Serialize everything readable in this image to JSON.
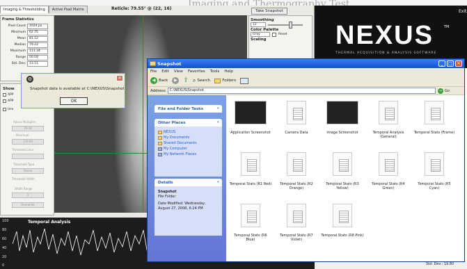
{
  "header_fragment": "Imaging and Thermography Test",
  "app": {
    "tabs": [
      "Imaging & Thresholding",
      "Active Pixel Matrix"
    ],
    "reticle": "Reticle: 79.55° @ (22, 16)",
    "take_snapshot": "Take Snapshot",
    "frame_stats": {
      "title": "Frame Statistics",
      "rows": [
        {
          "k": "Pixel Count",
          "v": "1024 px"
        },
        {
          "k": "Minimum",
          "v": "62.75"
        },
        {
          "k": "Mean",
          "v": "81.12"
        },
        {
          "k": "Median",
          "v": "79.22"
        },
        {
          "k": "Maximum",
          "v": "113.34"
        },
        {
          "k": "Range",
          "v": "50.59"
        },
        {
          "k": "Std. Dev.",
          "v": "13.51"
        }
      ]
    },
    "smoothing": {
      "label": "Smoothing",
      "value": "12"
    },
    "palette": {
      "label": "Color Palette",
      "value": "Gray",
      "reset": "Reset"
    },
    "scaling": "Scaling",
    "show_label": "Show",
    "app_opts": [
      "APP",
      "APP"
    ],
    "use_label": "Use",
    "disabled_fields": [
      "Above Multiplier",
      "79.30",
      "Minimum",
      "229.00",
      "Threshold Color",
      "Threshold Type",
      "Above",
      "Threshold Width",
      "Width Range",
      "1",
      "Overwrite"
    ]
  },
  "dialog": {
    "message": "Snapshot data is available at C:\\NEXUS\\Snapshot",
    "ok": "OK"
  },
  "graph": {
    "title": "Temporal Analysis",
    "yticks": [
      "100",
      "80",
      "60",
      "40",
      "20",
      "0"
    ]
  },
  "brand": {
    "name": "NEXUS",
    "tm": "TM",
    "tagline": "THERMAL ACQUISITION & ANALYSIS SOFTWARE",
    "exit": "Exit"
  },
  "bottom": {
    "stddev": "Std. Dev.: 19.80"
  },
  "explorer": {
    "title": "Snapshot",
    "menu": [
      "File",
      "Edit",
      "View",
      "Favorites",
      "Tools",
      "Help"
    ],
    "back": "Back",
    "search": "Search",
    "folders": "Folders",
    "address_label": "Address",
    "address": "C:\\NEXUS\\Snapshot",
    "go": "Go",
    "file_folder_tasks": "File and Folder Tasks",
    "other_places": {
      "title": "Other Places",
      "items": [
        "NEXUS",
        "My Documents",
        "Shared Documents",
        "My Computer",
        "My Network Places"
      ]
    },
    "details": {
      "title": "Details",
      "name": "Snapshot",
      "type": "File Folder",
      "modified": "Date Modified: Wednesday, August 27, 2008, 6:24 PM"
    },
    "files": [
      {
        "name": "Application Screenshot",
        "kind": "img"
      },
      {
        "name": "Camera Data",
        "kind": "doc"
      },
      {
        "name": "Image Screenshot",
        "kind": "img"
      },
      {
        "name": "Temporal Analysis (General)",
        "kind": "doc"
      },
      {
        "name": "Temporal Stats (Frame)",
        "kind": "doc"
      },
      {
        "name": "Temporal Stats (R1 Red)",
        "kind": "doc"
      },
      {
        "name": "Temporal Stats (R2 Orange)",
        "kind": "doc"
      },
      {
        "name": "Temporal Stats (R3 Yellow)",
        "kind": "doc"
      },
      {
        "name": "Temporal Stats (R4 Green)",
        "kind": "doc"
      },
      {
        "name": "Temporal Stats (R5 Cyan)",
        "kind": "doc"
      },
      {
        "name": "Temporal Stats (R6 Blue)",
        "kind": "doc"
      },
      {
        "name": "Temporal Stats (R7 Violet)",
        "kind": "doc"
      },
      {
        "name": "Temporal Stats (R8 Pink)",
        "kind": "doc"
      }
    ]
  }
}
